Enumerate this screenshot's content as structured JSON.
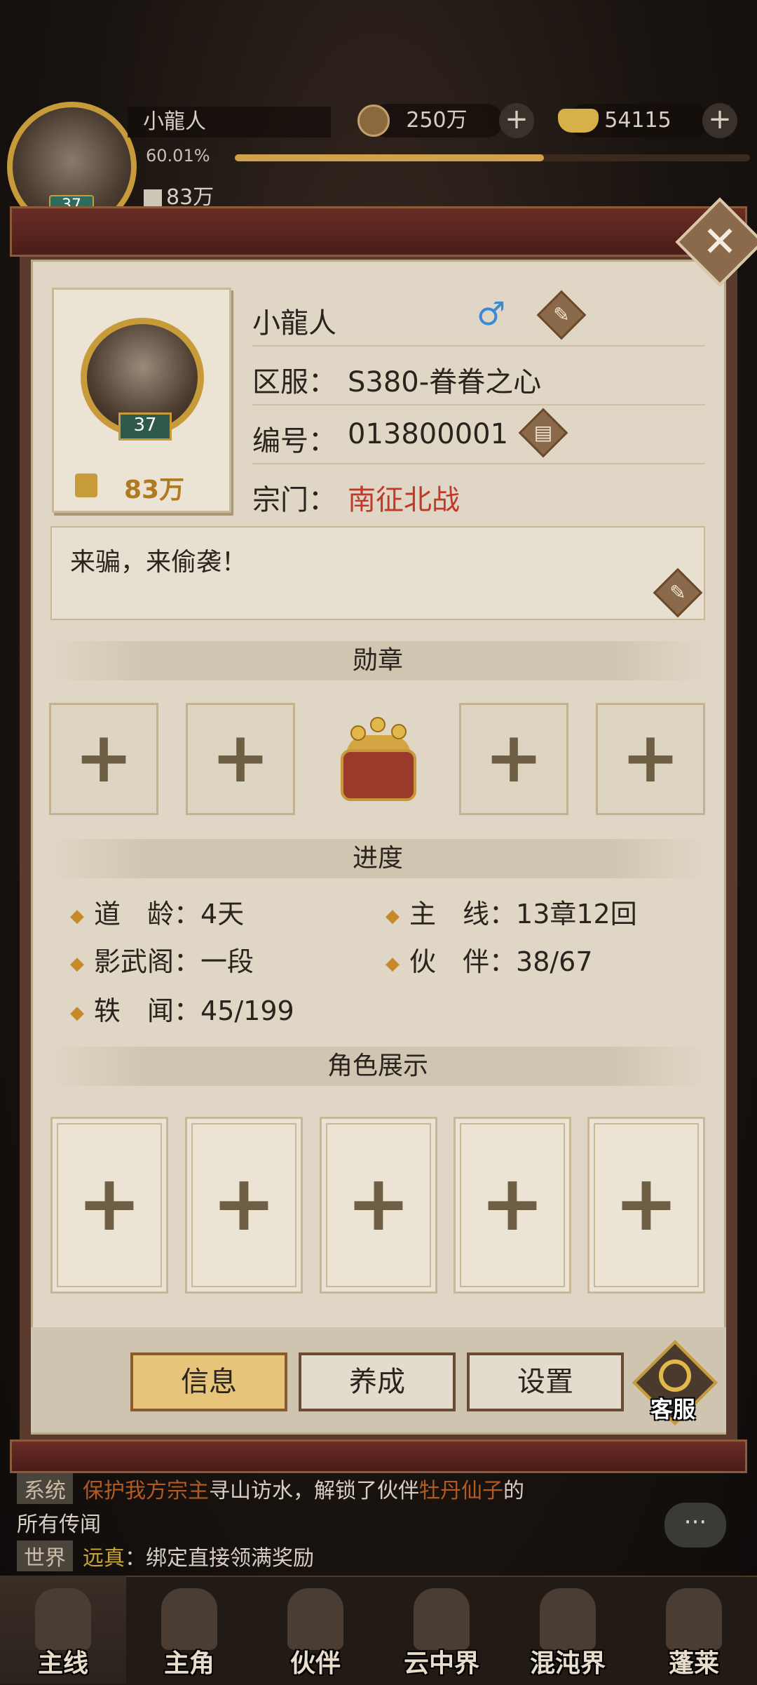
{
  "hud": {
    "player_name": "小龍人",
    "exp_percent_text": "60.01%",
    "exp_fraction": 0.6001,
    "level": "37",
    "power": "83万",
    "copper": "250万",
    "gold": "54115"
  },
  "profile": {
    "name": "小龍人",
    "level": "37",
    "power": "83万",
    "gender_symbol": "♂",
    "server_label": "区服：",
    "server_value": "S380-眷眷之心",
    "id_label": "编号：",
    "id_value": "013800001",
    "guild_label": "宗门：",
    "guild_value": "南征北战",
    "motto": "来骗，来偷袭！"
  },
  "sections": {
    "medals": "勋章",
    "progress": "进度",
    "showcase": "角色展示"
  },
  "progress": {
    "dao_age_label": "道　龄：",
    "dao_age_value": "4天",
    "mainline_label": "主　线：",
    "mainline_value": "13章12回",
    "shadow_pavilion_label": "影武阁：",
    "shadow_pavilion_value": "一段",
    "partners_label": "伙　伴：",
    "partners_value": "38/67",
    "anecdotes_label": "轶　闻：",
    "anecdotes_value": "45/199"
  },
  "tabs": {
    "info": "信息",
    "nurture": "养成",
    "settings": "设置",
    "service": "客服"
  },
  "chat": {
    "line1_tag": "系统",
    "line1_hl1": "保护我方宗主",
    "line1_mid": "寻山访水，解锁了伙伴",
    "line1_hl2": "牡丹仙子",
    "line1_end": "的",
    "line2": "所有传闻",
    "line3_tag": "世界",
    "line3_name": "远真",
    "line3_text": "：绑定直接领满奖励",
    "bubble": "···"
  },
  "nav": {
    "main": "主线",
    "hero": "主角",
    "partner": "伙伴",
    "cloud": "云中界",
    "chaos": "混沌界",
    "penglai": "蓬莱"
  }
}
